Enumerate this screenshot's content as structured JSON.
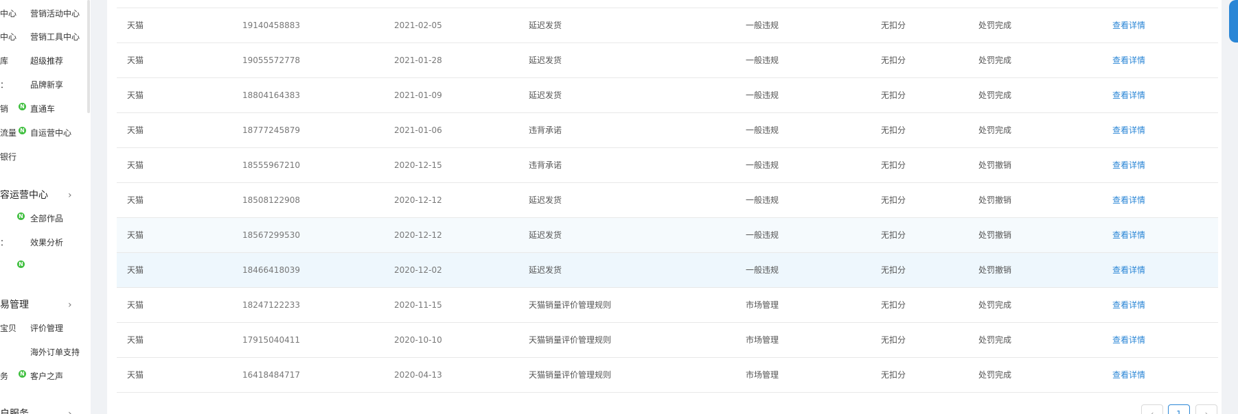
{
  "sidebar": {
    "rows": [
      {
        "c1": "中心",
        "c2": "营销活动中心",
        "badge": false
      },
      {
        "c1": "中心",
        "c2": "营销工具中心",
        "badge": false
      },
      {
        "c1": "库",
        "c2": "超级推荐",
        "badge": false
      },
      {
        "c1": "：",
        "c2": "品牌新享",
        "badge": false
      },
      {
        "c1": "销",
        "c2": "直通车",
        "badge": true
      },
      {
        "c1": "流量",
        "c2": "自运营中心",
        "badge": true
      },
      {
        "c1": "银行",
        "c2": "",
        "badge": false
      }
    ],
    "section1_title": "容运营中心",
    "section1_rows": [
      {
        "c1": "",
        "c2": "全部作品",
        "badge": true
      },
      {
        "c1": "：",
        "c2": "效果分析",
        "badge": false
      },
      {
        "c1": "",
        "c2": "",
        "badge": true
      }
    ],
    "section2_title": "易管理",
    "section2_rows": [
      {
        "c1": "宝贝",
        "c2": "评价管理",
        "badge": false
      },
      {
        "c1": "",
        "c2": "海外订单支持",
        "badge": false
      },
      {
        "c1": "务",
        "c2": "客户之声",
        "badge": true
      }
    ],
    "section3_title": "户服务",
    "chevron": "›",
    "badge_text": "N"
  },
  "table": {
    "rows": [
      {
        "platform": "天猫",
        "id": "19140458883",
        "date": "2021-02-05",
        "type": "延迟发货",
        "level": "一般违规",
        "deduct": "无扣分",
        "status": "处罚完成",
        "action": "查看详情"
      },
      {
        "platform": "天猫",
        "id": "19055572778",
        "date": "2021-01-28",
        "type": "延迟发货",
        "level": "一般违规",
        "deduct": "无扣分",
        "status": "处罚完成",
        "action": "查看详情"
      },
      {
        "platform": "天猫",
        "id": "18804164383",
        "date": "2021-01-09",
        "type": "延迟发货",
        "level": "一般违规",
        "deduct": "无扣分",
        "status": "处罚完成",
        "action": "查看详情"
      },
      {
        "platform": "天猫",
        "id": "18777245879",
        "date": "2021-01-06",
        "type": "违背承诺",
        "level": "一般违规",
        "deduct": "无扣分",
        "status": "处罚完成",
        "action": "查看详情"
      },
      {
        "platform": "天猫",
        "id": "18555967210",
        "date": "2020-12-15",
        "type": "违背承诺",
        "level": "一般违规",
        "deduct": "无扣分",
        "status": "处罚撤销",
        "action": "查看详情"
      },
      {
        "platform": "天猫",
        "id": "18508122908",
        "date": "2020-12-12",
        "type": "延迟发货",
        "level": "一般违规",
        "deduct": "无扣分",
        "status": "处罚撤销",
        "action": "查看详情"
      },
      {
        "platform": "天猫",
        "id": "18567299530",
        "date": "2020-12-12",
        "type": "延迟发货",
        "level": "一般违规",
        "deduct": "无扣分",
        "status": "处罚撤销",
        "action": "查看详情"
      },
      {
        "platform": "天猫",
        "id": "18466418039",
        "date": "2020-12-02",
        "type": "延迟发货",
        "level": "一般违规",
        "deduct": "无扣分",
        "status": "处罚撤销",
        "action": "查看详情"
      },
      {
        "platform": "天猫",
        "id": "18247122233",
        "date": "2020-11-15",
        "type": "天猫销量评价管理规则",
        "level": "市场管理",
        "deduct": "无扣分",
        "status": "处罚完成",
        "action": "查看详情"
      },
      {
        "platform": "天猫",
        "id": "17915040411",
        "date": "2020-10-10",
        "type": "天猫销量评价管理规则",
        "level": "市场管理",
        "deduct": "无扣分",
        "status": "处罚完成",
        "action": "查看详情"
      },
      {
        "platform": "天猫",
        "id": "16418484717",
        "date": "2020-04-13",
        "type": "天猫销量评价管理规则",
        "level": "市场管理",
        "deduct": "无扣分",
        "status": "处罚完成",
        "action": "查看详情"
      }
    ]
  },
  "pagination": {
    "prev": "‹",
    "current": "1",
    "next": "›"
  },
  "colors": {
    "link": "#2a86d6",
    "badge": "#3fbf3f",
    "row_highlight": "#eef7fd"
  }
}
